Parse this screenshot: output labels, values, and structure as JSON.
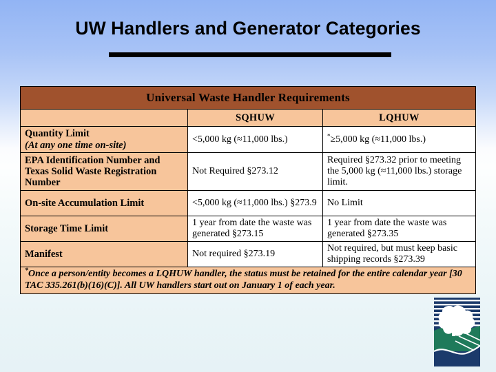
{
  "slide": {
    "title": "UW Handlers and Generator Categories"
  },
  "table": {
    "banner": "Universal Waste Handler Requirements",
    "columns": {
      "label_blank": "",
      "sqhuw": "SQHUW",
      "lqhuw": "LQHUW"
    },
    "rows": [
      {
        "label": "Quantity Limit",
        "label_sub": "(At any one time on-site)",
        "sqhuw": "<5,000 kg (≈11,000 lbs.)",
        "lqhuw_marker": "*",
        "lqhuw": "≥5,000 kg (≈11,000 lbs.)"
      },
      {
        "label": "EPA Identification Number and Texas Solid Waste Registration Number",
        "label_sub": "",
        "sqhuw": "Not Required §273.12",
        "lqhuw_marker": "",
        "lqhuw": "Required §273.32 prior to meeting the 5,000 kg (≈11,000 lbs.) storage limit."
      },
      {
        "label": "On-site Accumulation Limit",
        "label_sub": "",
        "sqhuw": "<5,000 kg (≈11,000 lbs.) §273.9",
        "lqhuw_marker": "",
        "lqhuw": "No Limit"
      },
      {
        "label": "Storage Time Limit",
        "label_sub": "",
        "sqhuw": "1 year from date the waste was generated §273.15",
        "lqhuw_marker": "",
        "lqhuw": "1 year from date the waste was generated §273.35"
      },
      {
        "label": "Manifest",
        "label_sub": "",
        "sqhuw": "Not required §273.19",
        "lqhuw_marker": "",
        "lqhuw": "Not required, but must keep basic shipping records §273.39"
      }
    ],
    "footnote_marker": "*",
    "footnote": "Once a person/entity becomes a LQHUW handler, the status must be retained for the entire calendar year [30 TAC 335.261(b)(16)(C)]. All UW handlers start out on January 1 of each year."
  },
  "logo": {
    "name": "tceq-logo",
    "sky_color": "#1b3a6b",
    "hill_color": "#1f7a5a",
    "cloud_color": "#ffffff"
  }
}
